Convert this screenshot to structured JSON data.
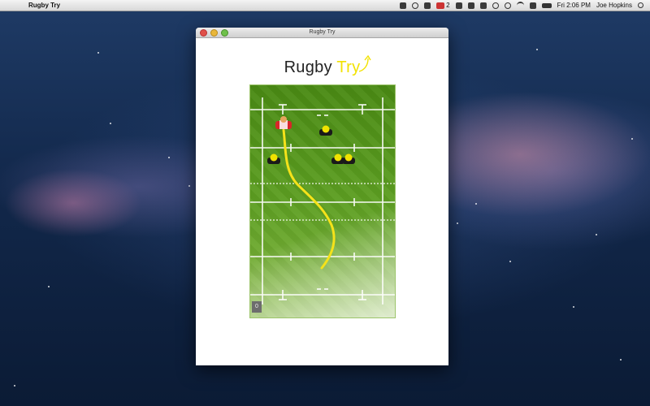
{
  "menubar": {
    "app_name": "Rugby Try",
    "gmail_count": "2",
    "clock": "Fri 2:06 PM",
    "user": "Joe Hopkins"
  },
  "window": {
    "title": "Rugby Try"
  },
  "game": {
    "logo_word1": "Rugby",
    "logo_word2": "Try",
    "score": "0",
    "colors": {
      "field": "#5d9f22",
      "accent": "#f2e200",
      "home_kit": "#d8262a",
      "opponent_kit": "#1a1a1a"
    }
  }
}
